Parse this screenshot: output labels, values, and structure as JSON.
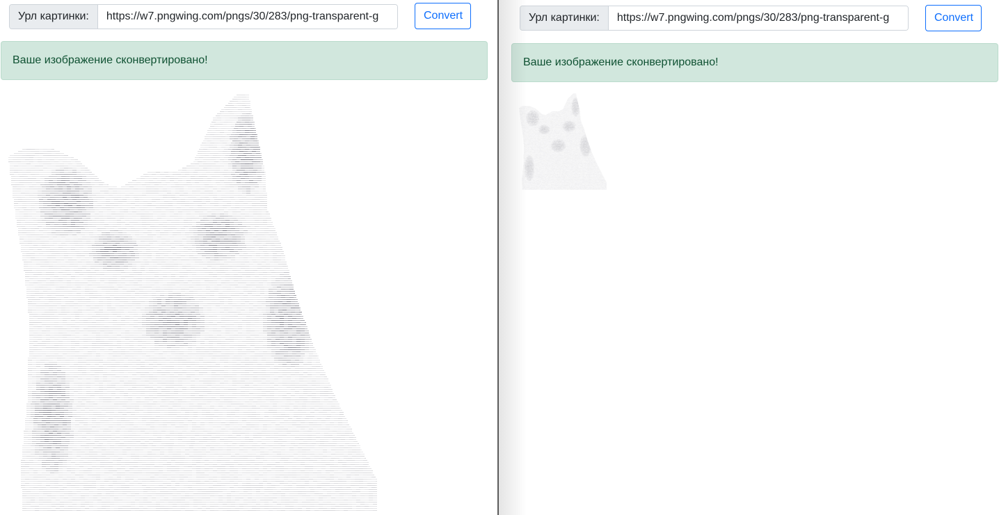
{
  "left_pane": {
    "input_label": "Урл картинки:",
    "input_value": "https://w7.pngwing.com/pngs/30/283/png-transparent-g",
    "convert_label": "Convert",
    "alert_text": "Ваше изображение сконвертировано!"
  },
  "right_pane": {
    "input_label": "Урл картинки:",
    "input_value": "https://w7.pngwing.com/pngs/30/283/png-transparent-g",
    "convert_label": "Convert",
    "alert_text": "Ваше изображение сконвертировано!"
  },
  "colors": {
    "primary": "#0d6efd",
    "alert_bg": "#d1e7dd",
    "alert_text": "#0f5132",
    "ascii_ink": "#6c6c78"
  }
}
